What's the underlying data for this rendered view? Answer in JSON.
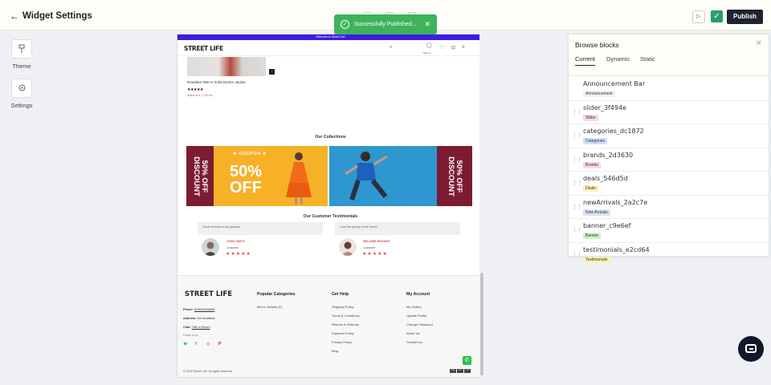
{
  "header": {
    "back_glyph": "←",
    "title": "Widget Settings",
    "publish_label": "Publish",
    "play_glyph": "▷",
    "check_glyph": "✓"
  },
  "toast": {
    "message": "Successfully Published...",
    "icon": "✓",
    "close": "✕"
  },
  "sidebar": {
    "items": [
      {
        "label": "Theme",
        "icon": "paint-bucket-icon"
      },
      {
        "label": "Settings",
        "icon": "gear-icon"
      }
    ]
  },
  "preview": {
    "announcement": "Welcome to Street Life!",
    "logo": "STREET LIFE",
    "signin": "Sign In",
    "product": {
      "name": "Roadster Men's Solid Denim Jacket",
      "stars": "★★★★★",
      "price_prefix": "Starts at",
      "price": "₹ 1,318.40"
    },
    "collections_title": "Our Collections",
    "banner_left": {
      "ticket": "50% OFF DISCOUNT",
      "coupon": "★ COUPON ★",
      "big": "50% OFF"
    },
    "banner_right": {
      "ticket": "50% OFF DISCOUNT"
    },
    "testimonials_title": "Our Customer Testimonials",
    "testimonials": [
      {
        "quote": "Great website to buy jackets!",
        "name": "JOHN SMITH",
        "role": "Customer",
        "stars": "★★★★★"
      },
      {
        "quote": "Love the quality of the items!",
        "name": "MELANIE RHODES",
        "role": "Customer",
        "stars": "★★★★★"
      }
    ],
    "footer": {
      "logo": "STREET LIFE",
      "phone_label": "Phone:",
      "phone": "919849096490",
      "address_label": "Address:",
      "address": "Not Available",
      "chat_label": "Chat:",
      "chat": "Talk to Expert",
      "follow": "Follow us on",
      "social": {
        "twitter": "🐦",
        "facebook": "f",
        "instagram": "◎",
        "pinterest": "P"
      },
      "col1_title": "Popular Categories",
      "col1": [
        "Men's Jackets (1)"
      ],
      "col2_title": "Get Help",
      "col2": [
        "Shipping Policy",
        "Terms & Conditions",
        "Returns & Refunds",
        "Payment Policy",
        "Privacy Policy",
        "Blog"
      ],
      "col3_title": "My Account",
      "col3": [
        "My Orders",
        "Update Profile",
        "Change Password",
        "About Us",
        "Contact Us"
      ],
      "copyright": "© 2022 Street Life. All rights reserved",
      "whatsapp_glyph": "✆",
      "cards": [
        "VISA",
        "MC",
        "UPI"
      ]
    }
  },
  "panel": {
    "title": "Browse blocks",
    "close": "✕",
    "tabs": [
      "Current",
      "Dynamic",
      "Static"
    ],
    "drag_glyph": "⋮⋮",
    "blocks": [
      {
        "name": "Announcement Bar",
        "tag": "Announcement",
        "tag_color": "#eef0f2",
        "draggable": false
      },
      {
        "name": "slider_3f494e",
        "tag": "Slider",
        "tag_color": "#fbd7dc",
        "draggable": true
      },
      {
        "name": "categories_dc1872",
        "tag": "Categories",
        "tag_color": "#cfe1f7",
        "draggable": true
      },
      {
        "name": "brands_2d3630",
        "tag": "Brands",
        "tag_color": "#fbd7dc",
        "draggable": true
      },
      {
        "name": "deals_546d5d",
        "tag": "Deals",
        "tag_color": "#fbf0b8",
        "draggable": true
      },
      {
        "name": "newArrivals_2a2c7e",
        "tag": "New Arrivals",
        "tag_color": "#d9e2f3",
        "draggable": true
      },
      {
        "name": "banner_c9e6ef",
        "tag": "Banner",
        "tag_color": "#cdf0cc",
        "draggable": true
      },
      {
        "name": "testimonials_e2cd64",
        "tag": "Testimonials",
        "tag_color": "#fbf0b8",
        "draggable": true
      }
    ]
  },
  "colors": {
    "accent": "#1e2330",
    "toast": "#3fb35b",
    "announcement": "#3d1de0",
    "chat": "#12182a"
  }
}
